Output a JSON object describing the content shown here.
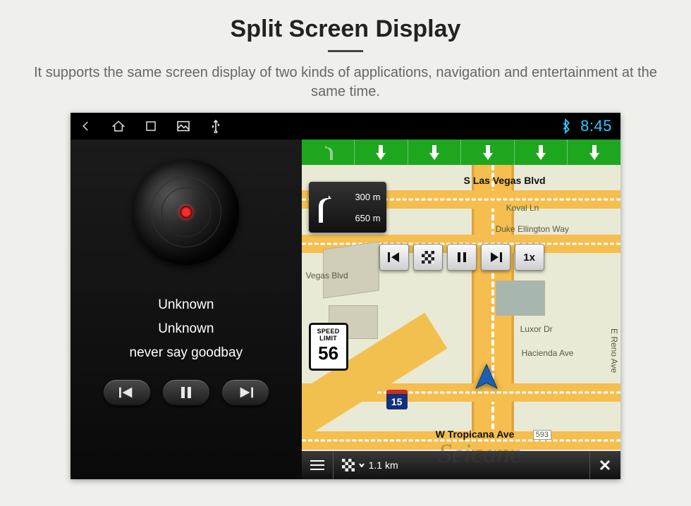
{
  "page": {
    "title": "Split Screen Display",
    "description": "It supports the same screen display of two kinds of applications, navigation and entertainment at the same time."
  },
  "status_bar": {
    "icons": [
      "back-icon",
      "home-icon",
      "recent-apps-icon",
      "picture-icon",
      "usb-icon"
    ],
    "bluetooth": true,
    "clock": "8:45"
  },
  "music": {
    "title": "Unknown",
    "artist": "Unknown",
    "track": "never say goodbay"
  },
  "nav": {
    "lanes": [
      "left-dim",
      "down",
      "down",
      "down",
      "down",
      "down"
    ],
    "turn_card": {
      "near": "300 m",
      "far": "650 m"
    },
    "speed_limit": {
      "label_top": "SPEED",
      "label_bottom": "LIMIT",
      "value": "56"
    },
    "sim_speed": "1x",
    "interstate": "15",
    "streets": {
      "s_las_vegas": "S Las Vegas Blvd",
      "koval": "Koval Ln",
      "duke": "Duke Ellington Way",
      "vegas_blvd_short": "Vegas Blvd",
      "luxor": "Luxor Dr",
      "hacienda": "Hacienda Ave",
      "reno": "E Reno Ave",
      "tropicana": "W Tropicana Ave",
      "tropicana_num": "593"
    },
    "bottom_bar": {
      "distance_to_waypoint": "1.1 km"
    }
  },
  "watermark": "Seicane"
}
